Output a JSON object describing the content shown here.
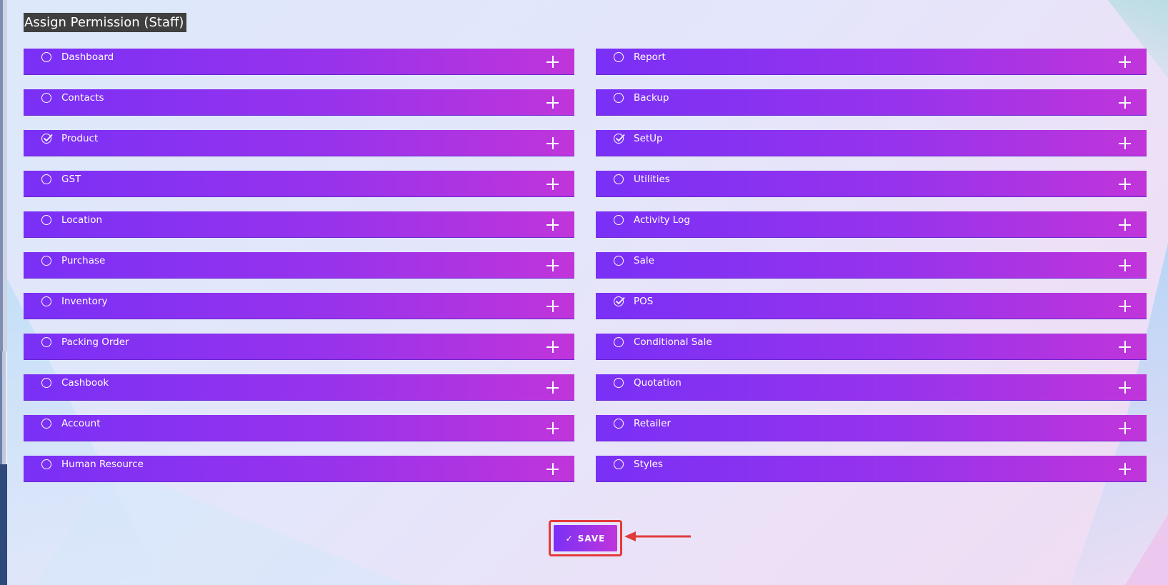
{
  "page": {
    "title": "Assign Permission (Staff)"
  },
  "colors": {
    "row_gradient_start": "#7a30f6",
    "row_gradient_end": "#c035da",
    "annotation_red": "#e23b3b"
  },
  "permissions": {
    "left": [
      {
        "label": "Dashboard",
        "checked": false
      },
      {
        "label": "Contacts",
        "checked": false
      },
      {
        "label": "Product",
        "checked": true
      },
      {
        "label": "GST",
        "checked": false
      },
      {
        "label": "Location",
        "checked": false
      },
      {
        "label": "Purchase",
        "checked": false
      },
      {
        "label": "Inventory",
        "checked": false
      },
      {
        "label": "Packing Order",
        "checked": false
      },
      {
        "label": "Cashbook",
        "checked": false
      },
      {
        "label": "Account",
        "checked": false
      },
      {
        "label": "Human Resource",
        "checked": false
      }
    ],
    "right": [
      {
        "label": "Report",
        "checked": false
      },
      {
        "label": "Backup",
        "checked": false
      },
      {
        "label": "SetUp",
        "checked": true
      },
      {
        "label": "Utilities",
        "checked": false
      },
      {
        "label": "Activity Log",
        "checked": false
      },
      {
        "label": "Sale",
        "checked": false
      },
      {
        "label": "POS",
        "checked": true
      },
      {
        "label": "Conditional Sale",
        "checked": false
      },
      {
        "label": "Quotation",
        "checked": false
      },
      {
        "label": "Retailer",
        "checked": false
      },
      {
        "label": "Styles",
        "checked": false
      }
    ]
  },
  "icons": {
    "expand": "plus-icon",
    "check": "check-icon",
    "annotation": "arrow-left-icon"
  },
  "save": {
    "check_glyph": "✓",
    "label": "SAVE"
  }
}
